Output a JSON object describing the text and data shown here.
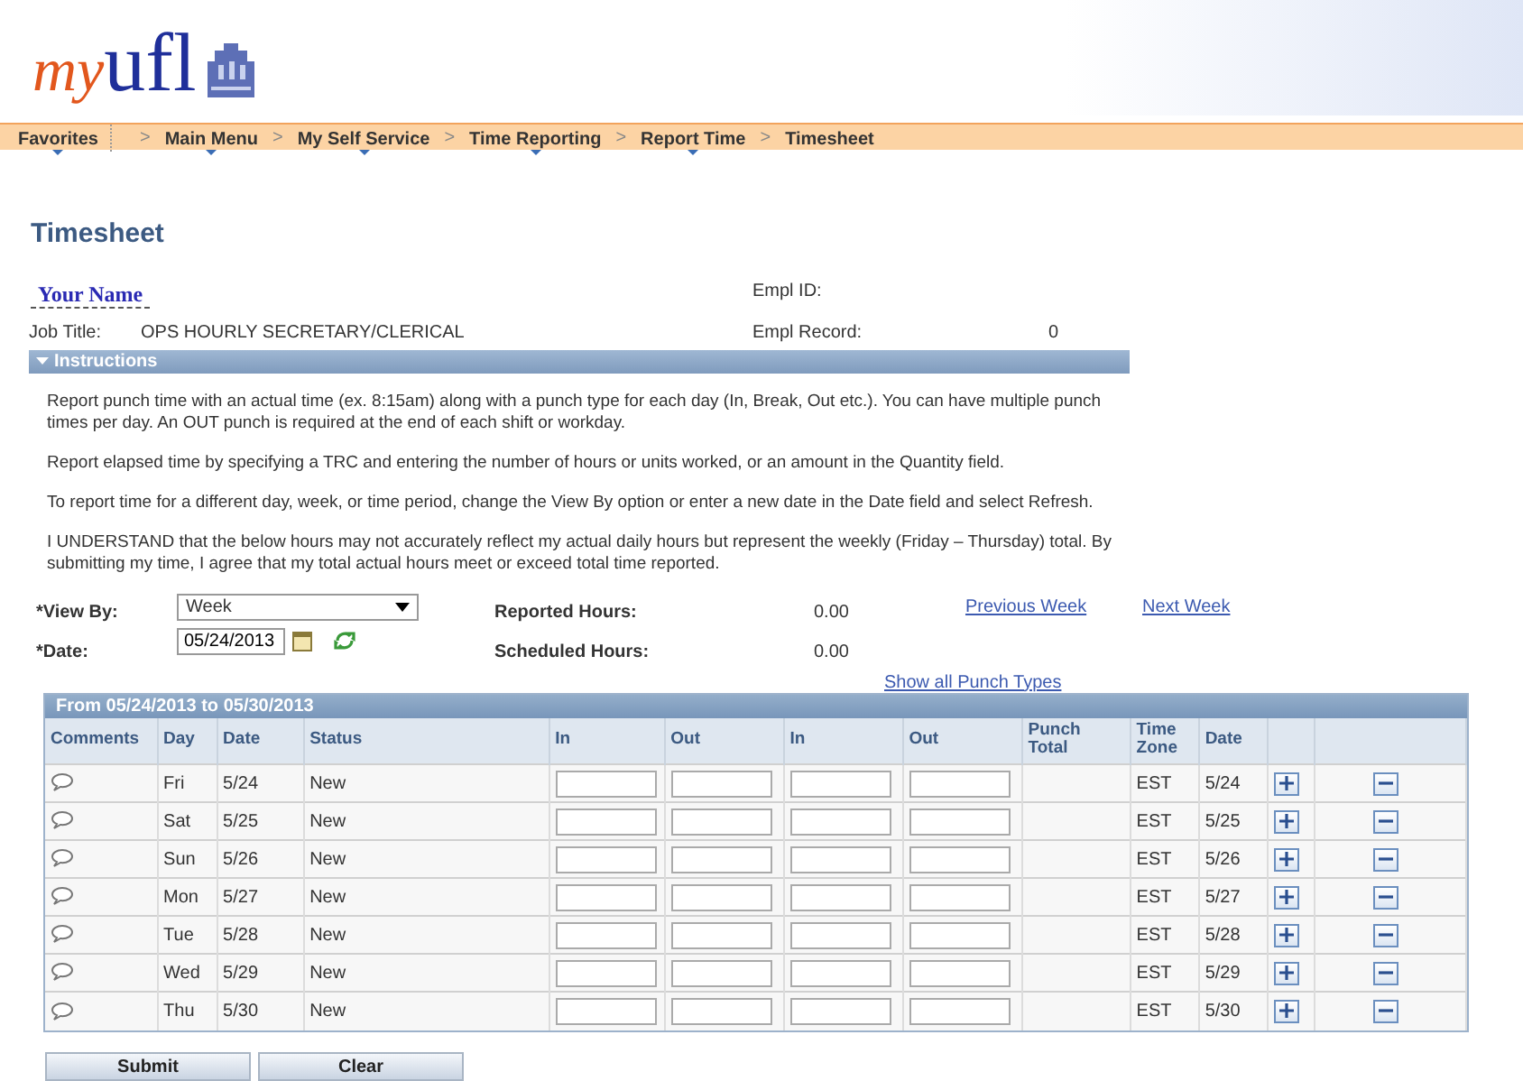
{
  "logo": {
    "part_1": "my",
    "part_2": "ufl"
  },
  "breadcrumb": [
    {
      "label": "Favorites",
      "has_menu": true
    },
    {
      "label": "Main Menu",
      "separator": ">",
      "has_menu": true
    },
    {
      "label": "My Self Service",
      "separator": ">",
      "has_menu": true
    },
    {
      "label": "Time Reporting",
      "separator": ">",
      "has_menu": true
    },
    {
      "label": "Report Time",
      "separator": ">",
      "has_menu": true
    },
    {
      "label": "Timesheet",
      "separator": ">",
      "has_menu": false
    }
  ],
  "title": "Timesheet",
  "employee": {
    "name": "Your Name",
    "empl_id_label": "Empl ID:",
    "job_title_label": "Job Title:",
    "job_title": "OPS HOURLY SECRETARY/CLERICAL",
    "empl_record_label": "Empl Record:",
    "empl_record": "0"
  },
  "instructions": {
    "title": "Instructions",
    "expanded": true,
    "paragraphs": [
      "Report punch time with an actual time (ex. 8:15am) along with a punch type for each day (In, Break, Out etc.).  You can have multiple punch times per day. An OUT punch is required at the end of each shift or workday.",
      "Report elapsed time by specifying a TRC and entering the number of hours or units worked, or an amount in the Quantity field.",
      "To report time for a different day, week, or time period, change the View By option or enter a new date in the Date field and select Refresh.",
      "I UNDERSTAND that the below hours may not accurately reflect my actual daily hours but represent the weekly (Friday – Thursday) total.  By submitting my time, I agree that my total actual hours meet or exceed total time reported."
    ]
  },
  "form": {
    "view_by_label": "*View By:",
    "view_by": "Week",
    "date_label": "*Date:",
    "date": "05/24/2013",
    "reported_hours_label": "Reported Hours:",
    "reported_hours": "0.00",
    "scheduled_hours_label": "Scheduled Hours:",
    "scheduled_hours": "0.00",
    "previous_link": "Previous Week",
    "next_link": "Next Week",
    "show_all_link": "Show all Punch Types"
  },
  "grid": {
    "title": "From 05/24/2013 to 05/30/2013",
    "columns": [
      "Comments",
      "Day",
      "Date",
      "Status",
      "In",
      "Out",
      "In",
      "Out",
      "Punch Total",
      "Time Zone",
      "Date"
    ],
    "rows": [
      {
        "day": "Fri",
        "date": "5/24",
        "status": "New",
        "time_zone": "EST",
        "date_2": "5/24"
      },
      {
        "day": "Sat",
        "date": "5/25",
        "status": "New",
        "time_zone": "EST",
        "date_2": "5/25"
      },
      {
        "day": "Sun",
        "date": "5/26",
        "status": "New",
        "time_zone": "EST",
        "date_2": "5/26"
      },
      {
        "day": "Mon",
        "date": "5/27",
        "status": "New",
        "time_zone": "EST",
        "date_2": "5/27"
      },
      {
        "day": "Tue",
        "date": "5/28",
        "status": "New",
        "time_zone": "EST",
        "date_2": "5/28"
      },
      {
        "day": "Wed",
        "date": "5/29",
        "status": "New",
        "time_zone": "EST",
        "date_2": "5/29"
      },
      {
        "day": "Thu",
        "date": "5/30",
        "status": "New",
        "time_zone": "EST",
        "date_2": "5/30"
      }
    ]
  },
  "buttons": [
    "Submit",
    "Clear"
  ]
}
